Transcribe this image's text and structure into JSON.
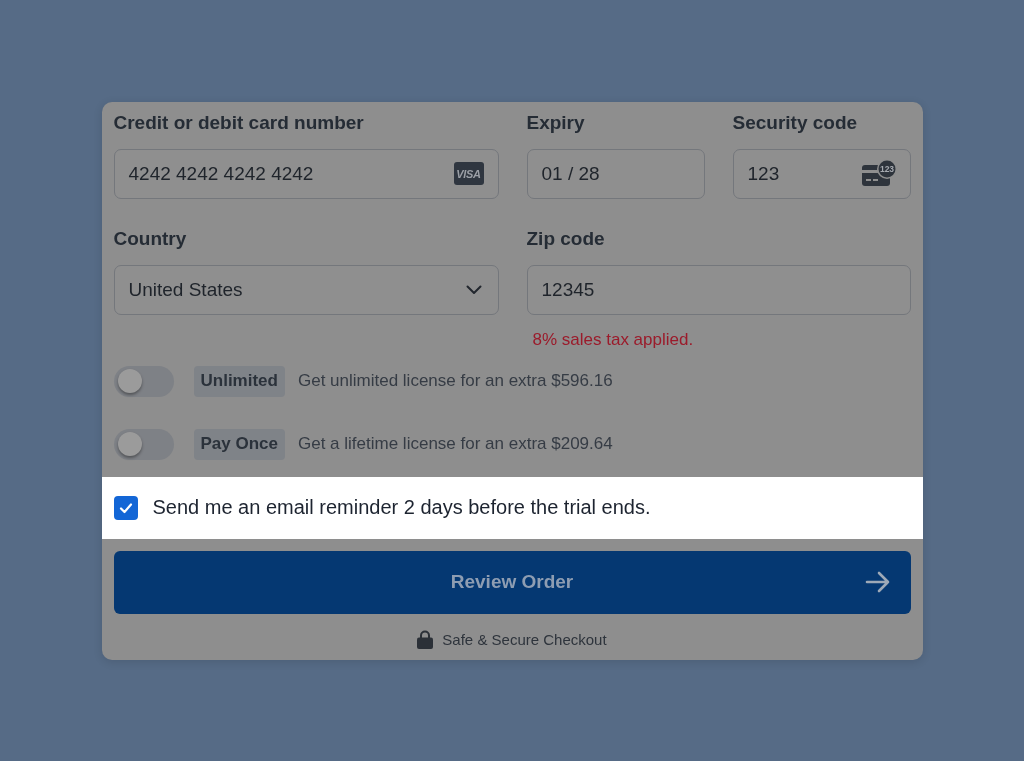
{
  "field_rows": [
    [
      {
        "kind": "card",
        "label": "Credit or debit card number",
        "value": "4242 4242 4242 4242",
        "badge": "VISA"
      },
      {
        "kind": "text",
        "label": "Expiry",
        "value": "01 / 28"
      },
      {
        "kind": "cvc",
        "label": "Security code",
        "value": "123",
        "icon_text": "123"
      }
    ],
    [
      {
        "kind": "select",
        "label": "Country",
        "value": "United States"
      },
      {
        "kind": "text",
        "label": "Zip code",
        "value": "12345",
        "note": "8% sales tax applied."
      }
    ]
  ],
  "addons": [
    {
      "on": false,
      "badge": "Unlimited",
      "description": "Get unlimited license for an extra $596.16"
    },
    {
      "on": false,
      "badge": "Pay Once",
      "description": "Get a lifetime license for an extra $209.64"
    }
  ],
  "reminder": {
    "spotlight": true,
    "checked": true,
    "label": "Send me an email reminder 2 days before the trial ends."
  },
  "submit_button": {
    "label": "Review Order"
  },
  "footer": {
    "text": "Safe & Secure Checkout"
  }
}
